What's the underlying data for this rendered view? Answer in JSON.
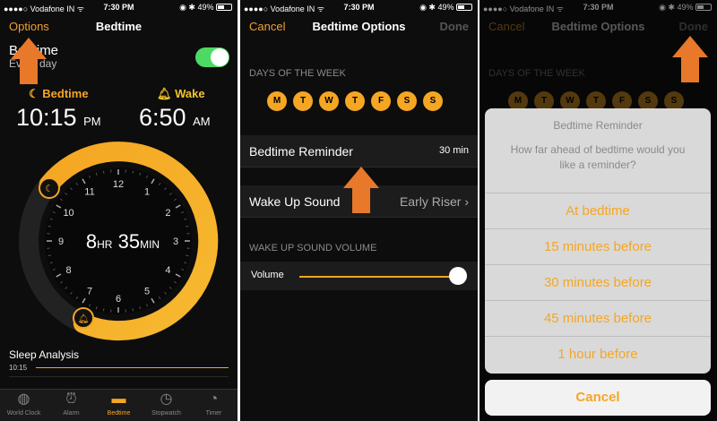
{
  "status": {
    "carrier": "●●●●○ Vodafone IN ᯤ",
    "time": "7:30 PM",
    "right": "◉ ✱ 49%"
  },
  "p1": {
    "nav_left": "Options",
    "nav_title": "Bedtime",
    "bedtime_label": "Bedtime",
    "bedtime_sub": "Every day",
    "bed_label": "Bedtime",
    "wake_label": "Wake",
    "bed_time": "10:15",
    "bed_ampm": "PM",
    "wake_time": "6:50",
    "wake_ampm": "AM",
    "dur_hr": "8",
    "dur_hr_u": "HR",
    "dur_min": "35",
    "dur_min_u": "MIN",
    "clock_numbers": [
      "12",
      "1",
      "2",
      "3",
      "4",
      "5",
      "6",
      "7",
      "8",
      "9",
      "10",
      "11"
    ],
    "sleep_title": "Sleep Analysis",
    "sleep_time": "10:15",
    "tabs": [
      {
        "label": "World Clock",
        "icon": "globe-icon"
      },
      {
        "label": "Alarm",
        "icon": "alarm-clock-icon"
      },
      {
        "label": "Bedtime",
        "icon": "bed-icon"
      },
      {
        "label": "Stopwatch",
        "icon": "stopwatch-icon"
      },
      {
        "label": "Timer",
        "icon": "timer-icon"
      }
    ]
  },
  "p2": {
    "nav_left": "Cancel",
    "nav_title": "Bedtime Options",
    "nav_right": "Done",
    "days_header": "DAYS OF THE WEEK",
    "days": [
      "M",
      "T",
      "W",
      "T",
      "F",
      "S",
      "S"
    ],
    "reminder_label": "Bedtime Reminder",
    "reminder_value": "30 min",
    "sound_label": "Wake Up Sound",
    "sound_value": "Early Riser",
    "volume_header": "WAKE UP SOUND VOLUME",
    "volume_label": "Volume",
    "volume_level": 1.0
  },
  "p3": {
    "nav_left": "Cancel",
    "nav_title": "Bedtime Options",
    "nav_right": "Done",
    "days_header": "DAYS OF THE WEEK",
    "sheet_title": "Bedtime Reminder",
    "sheet_msg": "How far ahead of bedtime would you like a reminder?",
    "options": [
      "At bedtime",
      "15 minutes before",
      "30 minutes before",
      "45 minutes before",
      "1 hour before"
    ],
    "cancel": "Cancel"
  },
  "colors": {
    "accent": "#f5a623",
    "annotation_arrow": "#e8782a",
    "toggle_on": "#4cd964"
  }
}
